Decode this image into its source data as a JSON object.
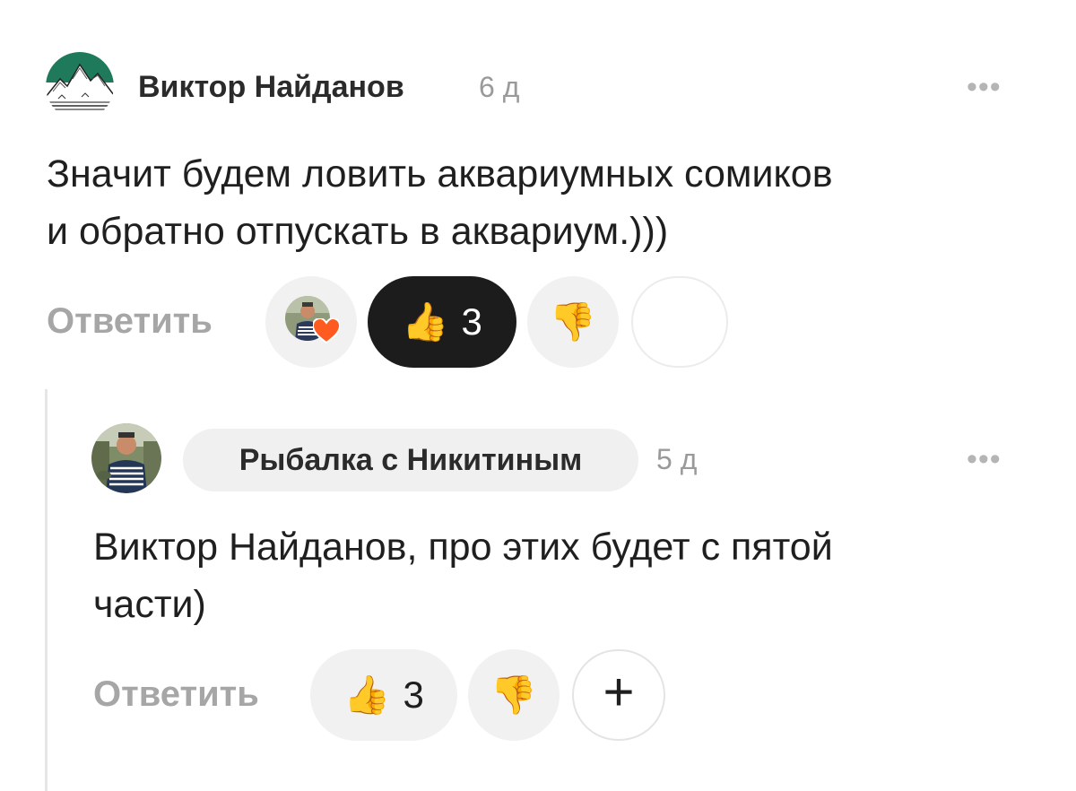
{
  "comment": {
    "author": "Виктор Найданов",
    "time": "6 д",
    "text_line1": "Значит будем ловить аквариумных сомиков",
    "text_line2": "и обратно отпускать в аквариум.)))",
    "reply_label": "Ответить",
    "like_count": "3",
    "more_icon": "•••",
    "icons": {
      "avatar": "mountain-logo-avatar",
      "reactor": "author-avatar-with-heart",
      "like": "thumbs-up-icon",
      "dislike": "thumbs-down-icon"
    }
  },
  "reply": {
    "author": "Рыбалка с Никитиным",
    "time": "5 д",
    "text_line1": "Виктор Найданов, про этих будет с пятой",
    "text_line2": "части)",
    "reply_label": "Ответить",
    "like_count": "3",
    "add_reaction": "+",
    "more_icon": "•••",
    "icons": {
      "avatar": "author-photo-avatar",
      "like": "thumbs-up-icon",
      "dislike": "thumbs-down-icon",
      "add": "plus-icon"
    }
  },
  "colors": {
    "active_pill": "#1c1c1c",
    "pill": "#f1f1f1",
    "heart": "#ff5a1f",
    "thumb": "#f7b21b"
  }
}
